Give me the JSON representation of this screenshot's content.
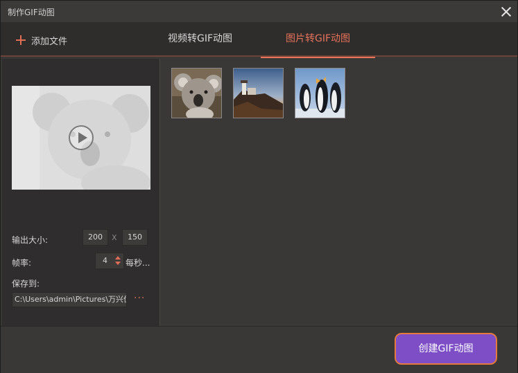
{
  "window": {
    "title": "制作GIF动图",
    "close_icon": "close-icon"
  },
  "toolbar": {
    "add_file_label": "添加文件",
    "add_icon": "plus-icon"
  },
  "tabs": [
    {
      "label": "视频转GIF动图",
      "active": false
    },
    {
      "label": "图片转GIF动图",
      "active": true
    }
  ],
  "settings": {
    "output_size_label": "输出大小:",
    "width": "200",
    "x_separator": "X",
    "height": "150",
    "frame_rate_label": "帧率:",
    "frame_rate": "4",
    "frame_rate_unit": "每秒...",
    "save_to_label": "保存到:",
    "save_path": "C:\\Users\\admin\\Pictures\\万兴优",
    "more_label": "···"
  },
  "thumbnails": [
    {
      "name": "koala"
    },
    {
      "name": "lighthouse"
    },
    {
      "name": "penguins"
    }
  ],
  "footer": {
    "create_button_label": "创建GIF动图"
  },
  "colors": {
    "accent": "#e8745a",
    "button": "#7d4ec6",
    "button_border": "#e67a3d"
  }
}
